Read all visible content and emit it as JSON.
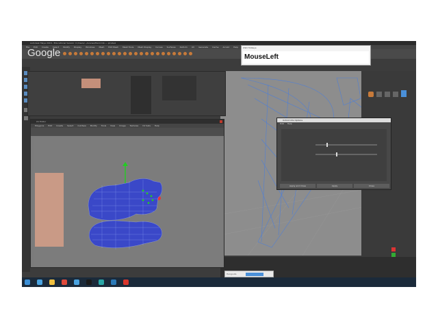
{
  "window": {
    "title": "Autodesk Maya 2016 - Educational Version: C:/Users/.../scenes/Hand.mb --- pCube1"
  },
  "menubar": {
    "items": [
      "File",
      "Edit",
      "Create",
      "Select",
      "Modify",
      "Display",
      "Windows",
      "Mesh",
      "Edit Mesh",
      "Mesh Tools",
      "Mesh Display",
      "Curves",
      "Surfaces",
      "Deform",
      "UV",
      "Generate",
      "Cache",
      "Arnold",
      "Help"
    ]
  },
  "overlay": {
    "google_logo": "Google",
    "keystroke_title": "OSD Hotkeys",
    "keystroke_text": "MouseLeft"
  },
  "uv_editor": {
    "title": "UV Editor",
    "menu": [
      "Polygons",
      "Edit",
      "Create",
      "Select",
      "Cut/Sew",
      "Modify",
      "Tools",
      "View",
      "Image",
      "Textures",
      "UV Sets",
      "Help"
    ]
  },
  "options_window": {
    "title": "Unfold UVs Options",
    "menu": [
      "Edit",
      "Help"
    ],
    "apply_close_label": "Apply and Close",
    "apply_label": "Apply",
    "close_label": "Close"
  },
  "video_controls": {
    "label": "Hangouts"
  },
  "colors": {
    "maya_bg": "#3c3c3c",
    "viewport_bg": "#8d8d8d",
    "wireframe": "#4f7fd6",
    "uv_mesh": "#3a48c8",
    "accent_orange": "#c77a3a",
    "taskbar": "#1b2a3a"
  }
}
